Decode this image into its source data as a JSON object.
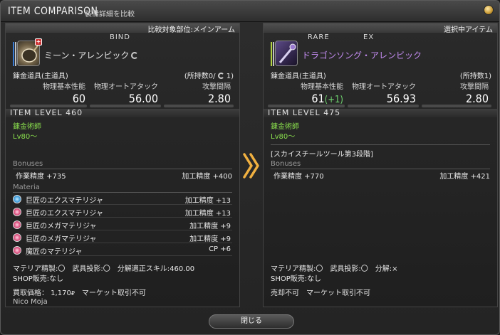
{
  "window": {
    "title": "ITEM COMPARISON",
    "subtitle": "装備詳細を比較",
    "close_label": "閉じる"
  },
  "left": {
    "header": "比較対象部位:メインアーム",
    "tags": [
      "BIND"
    ],
    "item_name": "ミーン・アレンビック",
    "category": "錬金道具(主道具)",
    "owned": "(所持数0/",
    "owned_suffix": " 1)",
    "stat_labels": [
      "物理基本性能",
      "物理オートアタック",
      "攻撃間隔"
    ],
    "stat_values": [
      "60",
      "56.00",
      "2.80"
    ],
    "item_level": "ITEM LEVEL 460",
    "job": "錬金術師",
    "level": "Lv80～",
    "bonuses_title": "Bonuses",
    "bonus_left": "作業精度 +735",
    "bonus_right": "加工精度 +400",
    "materia_title": "Materia",
    "materia": [
      {
        "name": "巨匠のエクスマテリジャ",
        "value": "加工精度 +13",
        "color": "#3a9ad9"
      },
      {
        "name": "巨匠のエクスマテリジャ",
        "value": "加工精度 +13",
        "color": "#d94a7a"
      },
      {
        "name": "巨匠のメガマテリジャ",
        "value": "加工精度 +9",
        "color": "#d94a7a"
      },
      {
        "name": "巨匠のメガマテリジャ",
        "value": "加工精度 +9",
        "color": "#d94a7a"
      },
      {
        "name": "魔匠のマテリジャ",
        "value": "CP +6",
        "color": "#d94a7a"
      }
    ],
    "info1": "マテリア精製:〇　武具投影:〇　分解適正スキル:460.00",
    "info2": "SHOP販売:なし",
    "info3": "買取価格： 1,170",
    "info3_suffix": "　マーケット取引不可",
    "crafter": "Nico Moja"
  },
  "right": {
    "header": "選択中アイテム",
    "tags": [
      "RARE",
      "EX"
    ],
    "item_name": "ドラゴンソング・アレンビック",
    "category": "錬金道具(主道具)",
    "owned": "(所持数1)",
    "stat_labels": [
      "物理基本性能",
      "物理オートアタック",
      "攻撃間隔"
    ],
    "stat_values": [
      "61",
      "56.93",
      "2.80"
    ],
    "stat_diff": "(+1)",
    "item_level": "ITEM LEVEL 475",
    "job": "錬金術師",
    "level": "Lv80～",
    "set_name": "[スカイスチールツール第3段階]",
    "bonuses_title": "Bonuses",
    "bonus_left": "作業精度 +770",
    "bonus_right": "加工精度 +421",
    "info1": "マテリア精製:〇　武具投影:〇　分解:×",
    "info2": "SHOP販売:なし",
    "info3": "売却不可　マーケット取引不可"
  },
  "colors": {
    "accent_green": "#8ae04d",
    "rare_purple": "#c48cf2",
    "arrow_gold": "#f0b040"
  },
  "icons": {
    "left_item": "alembic-pan-icon",
    "right_item": "dragonsong-alembic-icon",
    "hq": "hq-icon",
    "arrow": "double-chevron-right-icon"
  }
}
